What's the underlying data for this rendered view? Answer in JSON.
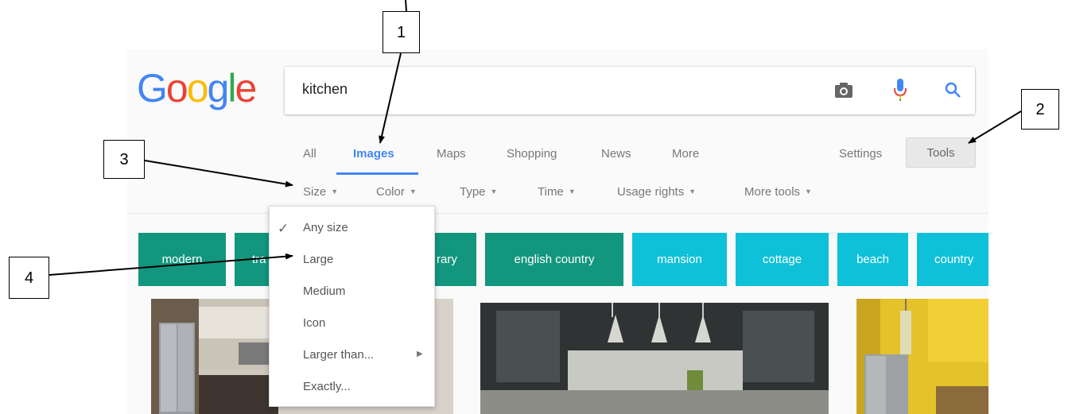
{
  "search": {
    "query": "kitchen"
  },
  "logo": {
    "letters": [
      "G",
      "o",
      "o",
      "g",
      "l",
      "e"
    ],
    "colors": [
      "#4285f4",
      "#ea4335",
      "#fbbc05",
      "#4285f4",
      "#34a853",
      "#ea4335"
    ]
  },
  "tabs": [
    {
      "label": "All"
    },
    {
      "label": "Images"
    },
    {
      "label": "Maps"
    },
    {
      "label": "Shopping"
    },
    {
      "label": "News"
    },
    {
      "label": "More"
    }
  ],
  "settings_label": "Settings",
  "tools_label": "Tools",
  "filters": [
    {
      "label": "Size"
    },
    {
      "label": "Color"
    },
    {
      "label": "Type"
    },
    {
      "label": "Time"
    },
    {
      "label": "Usage rights"
    },
    {
      "label": "More tools"
    }
  ],
  "chips": [
    {
      "label": "modern"
    },
    {
      "label": "tra"
    },
    {
      "label": "rary"
    },
    {
      "label": "english country"
    },
    {
      "label": "mansion"
    },
    {
      "label": "cottage"
    },
    {
      "label": "beach"
    },
    {
      "label": "country"
    }
  ],
  "size_menu": {
    "items": [
      {
        "label": "Any size",
        "checked": true
      },
      {
        "label": "Large"
      },
      {
        "label": "Medium"
      },
      {
        "label": "Icon"
      },
      {
        "label": "Larger than...",
        "submenu": true
      },
      {
        "label": "Exactly..."
      }
    ]
  },
  "annotations": [
    "1",
    "2",
    "3",
    "4"
  ],
  "colors": {
    "accent": "#4285f4",
    "chip_dark": "#12967e",
    "chip_light": "#0fc1d8"
  }
}
